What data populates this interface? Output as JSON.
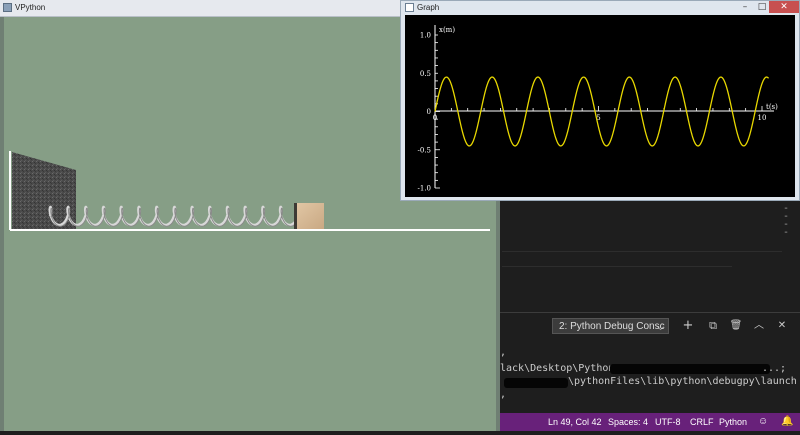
{
  "vpython_window": {
    "title": "VPython"
  },
  "graph_window": {
    "title": "Graph",
    "controls": {
      "minimize": "–",
      "maximize": "□",
      "close": "✕"
    }
  },
  "chart_data": {
    "type": "line",
    "ylabel": "x(m)",
    "xlabel": "t(s)",
    "xlim": [
      0,
      10
    ],
    "ylim": [
      -1.0,
      1.0
    ],
    "x_tick_labels": [
      "0",
      "5",
      "10"
    ],
    "y_tick_labels": [
      "1.0",
      "0.5",
      "0",
      "-0.5",
      "-1.0"
    ],
    "series": [
      {
        "color": "#e8d800",
        "amplitude": 0.45,
        "periods": 7.15,
        "phase_start": "zero-rising",
        "t_end": 10.2
      }
    ]
  },
  "terminal": {
    "selector_label": "2: Python Debug Consc",
    "add_label": "+",
    "split_label": "⧉",
    "trash_label": "🗑",
    "maximize_label": "︿",
    "close_label": "✕",
    "lines": [
      ",",
      "lack\\Desktop\\Python\\",
      "\\pythonFiles\\lib\\python\\debugpy\\launch",
      ","
    ],
    "line1_tail": "...;"
  },
  "statusbar": {
    "position": "Ln 49, Col 42",
    "spaces": "Spaces: 4",
    "encoding": "UTF-8",
    "eol": "CRLF",
    "language": "Python"
  },
  "colors": {
    "vpython_bg": "#869e86",
    "statusbar": "#68217a",
    "curve": "#e8d800"
  }
}
